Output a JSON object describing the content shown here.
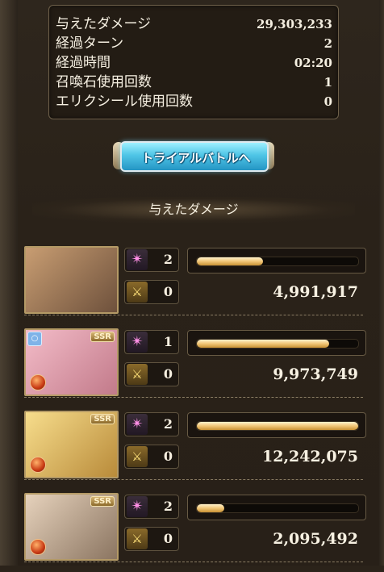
{
  "summary": {
    "rows": [
      {
        "label": "与えたダメージ",
        "value": "29,303,233"
      },
      {
        "label": "経過ターン",
        "value": "2"
      },
      {
        "label": "経過時間",
        "value": "02:20"
      },
      {
        "label": "召喚石使用回数",
        "value": "1"
      },
      {
        "label": "エリクシール使用回数",
        "value": "0"
      }
    ]
  },
  "trial_button": {
    "label": "トライアルバトルへ"
  },
  "section": {
    "title": "与えたダメージ"
  },
  "characters": [
    {
      "rarity": "",
      "element": "",
      "ability_count": "2",
      "ca_count": "0",
      "damage": "4,991,917",
      "bar_fraction": 0.41,
      "art_colors": [
        "#c89d72",
        "#6e513c"
      ]
    },
    {
      "rarity": "SSR",
      "element": "fire",
      "ability_count": "1",
      "ca_count": "0",
      "damage": "9,973,749",
      "bar_fraction": 0.82,
      "art_colors": [
        "#f3bcc8",
        "#c27a8a"
      ]
    },
    {
      "rarity": "SSR",
      "element": "fire",
      "ability_count": "2",
      "ca_count": "0",
      "damage": "12,242,075",
      "bar_fraction": 1.0,
      "art_colors": [
        "#f7dd8c",
        "#b98b3a"
      ]
    },
    {
      "rarity": "SSR",
      "element": "fire",
      "ability_count": "2",
      "ca_count": "0",
      "damage": "2,095,492",
      "bar_fraction": 0.17,
      "art_colors": [
        "#e6d2bc",
        "#8b7561"
      ]
    }
  ],
  "icons": {
    "ability": "pink-star-icon",
    "charge_attack": "crossed-swords-icon",
    "element": "fire-element-icon",
    "summon": "ring-icon"
  }
}
